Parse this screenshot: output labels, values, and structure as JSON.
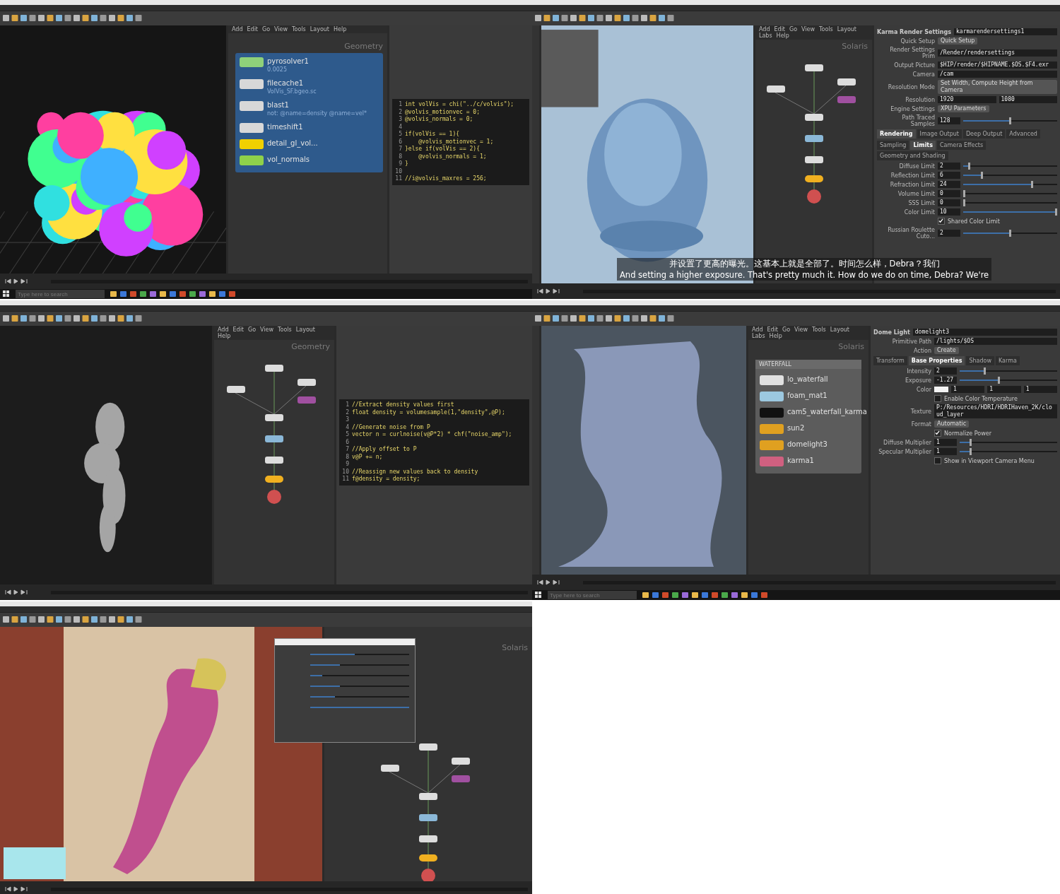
{
  "panels": [
    {
      "viewport": {
        "kind": "blobs"
      },
      "network": {
        "context": "Geometry",
        "menu": [
          "Add",
          "Edit",
          "Go",
          "View",
          "Tools",
          "Layout",
          "Help"
        ],
        "nodes": [
          {
            "name": "pyrosolver1",
            "notes": [
              "0.0025"
            ],
            "color": "#8fd17a"
          },
          {
            "name": "filecache1",
            "notes": [
              "VolVis_SF.bgeo.sc"
            ],
            "color": "#d8d8d8"
          },
          {
            "name": "blast1",
            "notes": [
              "not: @name=density @name=vel*"
            ],
            "color": "#d8d8d8"
          },
          {
            "name": "timeshift1",
            "color": "#d8d8d8"
          },
          {
            "name": "detail_gl_vol...",
            "color": "#f0d000"
          },
          {
            "name": "vol_normals",
            "color": "#8fd14a"
          }
        ]
      },
      "params": [
        {
          "kind": "code",
          "lines": [
            {
              "number": "1",
              "code": "int volVis = chi(\"../c/volvis\");"
            },
            {
              "number": "2",
              "code": "@volvis_motionvec = 0;"
            },
            {
              "number": "3",
              "code": "@volvis_normals = 0;"
            },
            {
              "number": "4"
            },
            {
              "number": "5",
              "code": "if(volVis == 1){"
            },
            {
              "number": "6",
              "code": "    @volvis_motionvec = 1;"
            },
            {
              "number": "7",
              "code": "}else if(volVis == 2){"
            },
            {
              "number": "8",
              "code": "    @volvis_normals = 1;"
            },
            {
              "number": "9",
              "code": "}"
            },
            {
              "number": "10"
            },
            {
              "number": "11",
              "code": "//i@volvis_maxres = 256;"
            }
          ]
        }
      ],
      "taskbar": {
        "placeholder": "Type here to search"
      }
    },
    {
      "viewport": {
        "kind": "water"
      },
      "subtitles": [
        "并设置了更高的曝光。这基本上就是全部了。时间怎么样，Debra？我们",
        "And setting a higher exposure. That's pretty much it. How do we do on time, Debra? We're"
      ],
      "network": {
        "context": "Solaris",
        "menu": [
          "Add",
          "Edit",
          "Go",
          "View",
          "Tools",
          "Layout",
          "Labs",
          "Help"
        ]
      },
      "params": [
        {
          "kind": "header",
          "label": "Karma Render Settings",
          "value": "karmarendersettings1"
        },
        {
          "kind": "menu",
          "label": "Quick Setup",
          "value": "Quick Setup"
        },
        {
          "kind": "field",
          "label": "Render Settings Prim",
          "value": "/Render/rendersettings"
        },
        {
          "kind": "field",
          "label": "Output Picture",
          "value": "$HIP/render/$HIPNAME.$OS.$F4.exr"
        },
        {
          "kind": "field",
          "label": "Camera",
          "value": "/cam"
        },
        {
          "kind": "menu",
          "label": "Resolution Mode",
          "value": "Set Width, Compute Height from Camera"
        },
        {
          "kind": "pair",
          "label": "Resolution",
          "values": [
            "1920",
            "1080"
          ]
        },
        {
          "kind": "menu",
          "label": "Engine Settings",
          "value": "XPU Parameters"
        },
        {
          "kind": "slider",
          "label": "Path Traced Samples",
          "value": "128",
          "level": 0.5
        },
        {
          "kind": "tabs",
          "tabs": [
            {
              "label": "Rendering",
              "selected": true
            },
            {
              "label": "Image Output",
              "selected": false
            },
            {
              "label": "Deep Output",
              "selected": false
            },
            {
              "label": "Advanced",
              "selected": false
            }
          ]
        },
        {
          "kind": "tabs",
          "tabs": [
            {
              "label": "Sampling",
              "selected": false
            },
            {
              "label": "Limits",
              "selected": true
            },
            {
              "label": "Camera Effects",
              "selected": false
            },
            {
              "label": "Geometry and Shading",
              "selected": false
            }
          ]
        },
        {
          "kind": "slider",
          "label": "Diffuse Limit",
          "value": "2",
          "level": 0.05
        },
        {
          "kind": "slider",
          "label": "Reflection Limit",
          "value": "6",
          "level": 0.19
        },
        {
          "kind": "slider",
          "label": "Refraction Limit",
          "value": "24",
          "level": 0.74
        },
        {
          "kind": "slider",
          "label": "Volume Limit",
          "value": "0",
          "level": 0
        },
        {
          "kind": "slider",
          "label": "SSS Limit",
          "value": "0",
          "level": 0
        },
        {
          "kind": "slider",
          "label": "Color Limit",
          "value": "10",
          "level": 1
        },
        {
          "kind": "check",
          "label": "Shared Color Limit",
          "checked": true
        },
        {
          "kind": "slider",
          "label": "Russian Roulette Cuto...",
          "value": "2",
          "level": 0.5
        }
      ]
    },
    {
      "viewport": {
        "kind": "smoke"
      },
      "network": {
        "context": "Geometry",
        "menu": [
          "Add",
          "Edit",
          "Go",
          "View",
          "Tools",
          "Layout",
          "Help"
        ]
      },
      "params": [
        {
          "kind": "code",
          "lines": [
            {
              "number": "1",
              "code": "//Extract density values first"
            },
            {
              "number": "2",
              "code": "float density = volumesample(1,\"density\",@P);"
            },
            {
              "number": "3"
            },
            {
              "number": "4",
              "code": "//Generate noise from P"
            },
            {
              "number": "5",
              "code": "vector n = curlnoise(v@P*2) * chf(\"noise_amp\");"
            },
            {
              "number": "6"
            },
            {
              "number": "7",
              "code": "//Apply offset to P"
            },
            {
              "number": "8",
              "code": "v@P += n;"
            },
            {
              "number": "9"
            },
            {
              "number": "10",
              "code": "//Reassign new values back to density"
            },
            {
              "number": "11",
              "code": "f@density = density;"
            }
          ]
        }
      ]
    },
    {
      "viewport": {
        "kind": "waterfall"
      },
      "network": {
        "context": "Solaris",
        "menu": [
          "Add",
          "Edit",
          "Go",
          "View",
          "Tools",
          "Layout",
          "Labs",
          "Help"
        ],
        "box": "WATERFALL",
        "nodes": [
          {
            "name": "lo_waterfall",
            "color": "#e0e0e0"
          },
          {
            "name": "foam_mat1",
            "color": "#9cc8e0"
          },
          {
            "name": "cam5_waterfall_karma",
            "color": "#111111"
          },
          {
            "name": "sun2",
            "color": "#e0a020"
          },
          {
            "name": "domelight3",
            "color": "#e0a020"
          },
          {
            "name": "karma1",
            "color": "#d06080"
          }
        ]
      },
      "params": [
        {
          "kind": "header",
          "label": "Dome Light",
          "value": "domelight3"
        },
        {
          "kind": "field",
          "label": "Primitive Path",
          "value": "/lights/$OS"
        },
        {
          "kind": "menu",
          "label": "Action",
          "value": "Create"
        },
        {
          "kind": "tabs",
          "tabs": [
            {
              "label": "Transform",
              "selected": false
            },
            {
              "label": "Base Properties",
              "selected": true
            },
            {
              "label": "Shadow",
              "selected": false
            },
            {
              "label": "Karma",
              "selected": false
            }
          ]
        },
        {
          "kind": "slider",
          "label": "Intensity",
          "value": "2",
          "level": 0.25
        },
        {
          "kind": "slider",
          "label": "Exposure",
          "value": "-1.27",
          "level": 0.4
        },
        {
          "kind": "color",
          "label": "Color",
          "values": [
            "1",
            "1",
            "1"
          ]
        },
        {
          "kind": "check",
          "label": "Enable Color Temperature",
          "checked": false
        },
        {
          "kind": "field",
          "label": "Texture",
          "value": "P:/Resources/HDRI/HDRIHaven_2K/cloud_layer"
        },
        {
          "kind": "menu",
          "label": "Format",
          "value": "Automatic"
        },
        {
          "kind": "check",
          "label": "Normalize Power",
          "checked": true
        },
        {
          "kind": "slider",
          "label": "Diffuse Multiplier",
          "value": "1",
          "level": 0.1
        },
        {
          "kind": "slider",
          "label": "Specular Multiplier",
          "value": "1",
          "level": 0.1
        },
        {
          "kind": "check",
          "label": "Show in Viewport Camera Menu",
          "checked": false
        }
      ],
      "taskbar": {
        "placeholder": "Type here to search"
      }
    },
    {
      "viewport": {
        "kind": "cloth"
      },
      "network": {
        "context": "Solaris"
      },
      "dialog": {
        "sliders": [
          {
            "level": 0.45
          },
          {
            "level": 0.3
          },
          {
            "level": 0.12
          },
          {
            "level": 0.3
          },
          {
            "level": 0.25
          },
          {
            "level": 1
          }
        ]
      }
    }
  ]
}
